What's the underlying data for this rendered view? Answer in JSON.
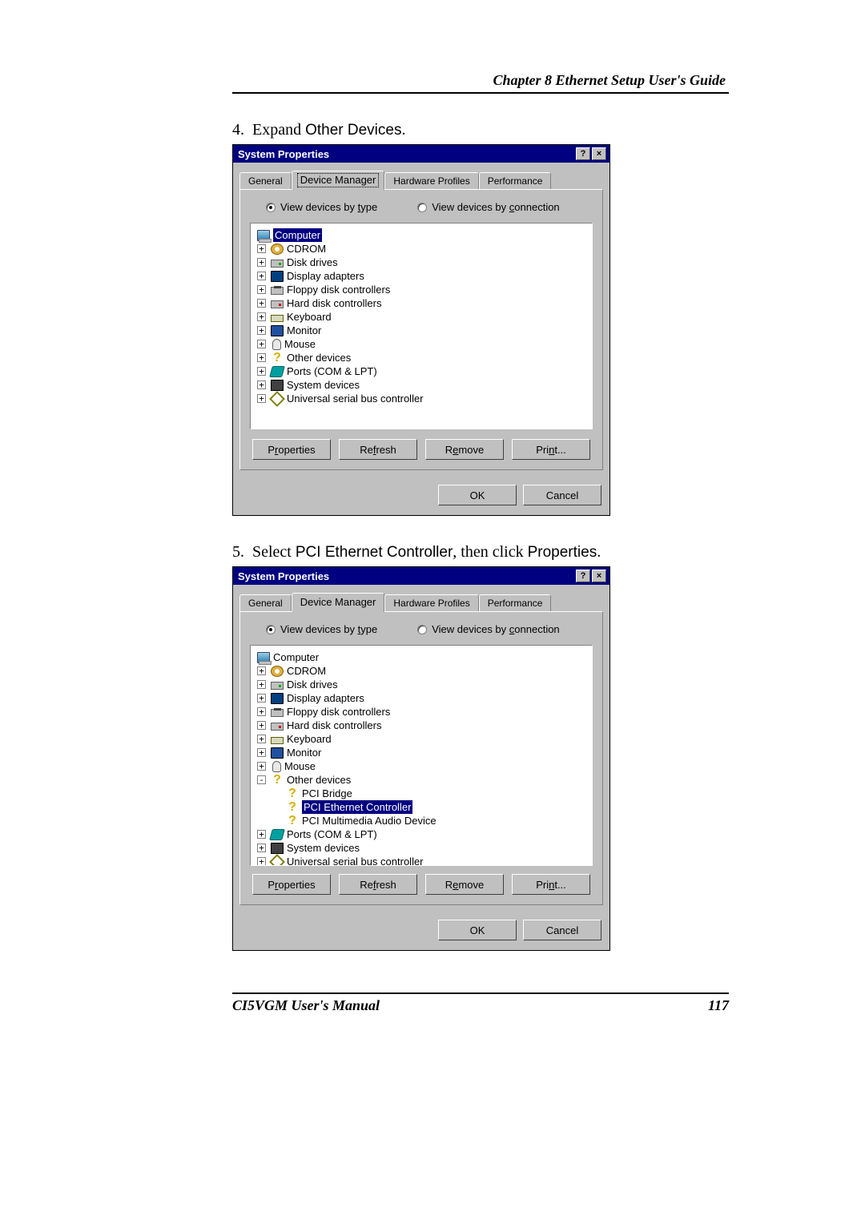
{
  "header": "Chapter 8  Ethernet Setup User's Guide",
  "step4": {
    "num": "4.",
    "prefix": "Expand ",
    "ui": "Other Devices",
    "suffix": "."
  },
  "step5": {
    "num": "5.",
    "prefix": "Select ",
    "ui1": "PCI Ethernet Controller",
    "mid": ", then click ",
    "ui2": "Properties",
    "suffix": "."
  },
  "dialog": {
    "title": "System Properties",
    "tabs": {
      "general": "General",
      "deviceManager": "Device Manager",
      "hardwareProfiles": "Hardware Profiles",
      "performance": "Performance"
    },
    "radios": {
      "byType": {
        "pre": "View devices by ",
        "u": "t",
        "post": "ype"
      },
      "byConn": {
        "pre": "View devices by ",
        "u": "c",
        "post": "onnection"
      }
    },
    "tree": {
      "computer": "Computer",
      "cdrom": "CDROM",
      "disk": "Disk drives",
      "display": "Display adapters",
      "floppy": "Floppy disk controllers",
      "hdd": "Hard disk controllers",
      "keyboard": "Keyboard",
      "monitor": "Monitor",
      "mouse": "Mouse",
      "other": "Other devices",
      "pciBridge": "PCI Bridge",
      "pciEth": "PCI Ethernet Controller",
      "pciAudio": "PCI Multimedia Audio Device",
      "ports": "Ports (COM & LPT)",
      "system": "System devices",
      "usb": "Universal serial bus controller"
    },
    "buttons": {
      "properties": {
        "pre": "P",
        "u": "r",
        "post": "operties"
      },
      "refresh": {
        "pre": "Re",
        "u": "f",
        "post": "resh"
      },
      "remove": {
        "pre": "R",
        "u": "e",
        "post": "move"
      },
      "print": {
        "pre": "Pri",
        "u": "n",
        "post": "t..."
      },
      "ok": "OK",
      "cancel": "Cancel"
    }
  },
  "footer": {
    "left": "CI5VGM User's Manual",
    "right": "117"
  }
}
